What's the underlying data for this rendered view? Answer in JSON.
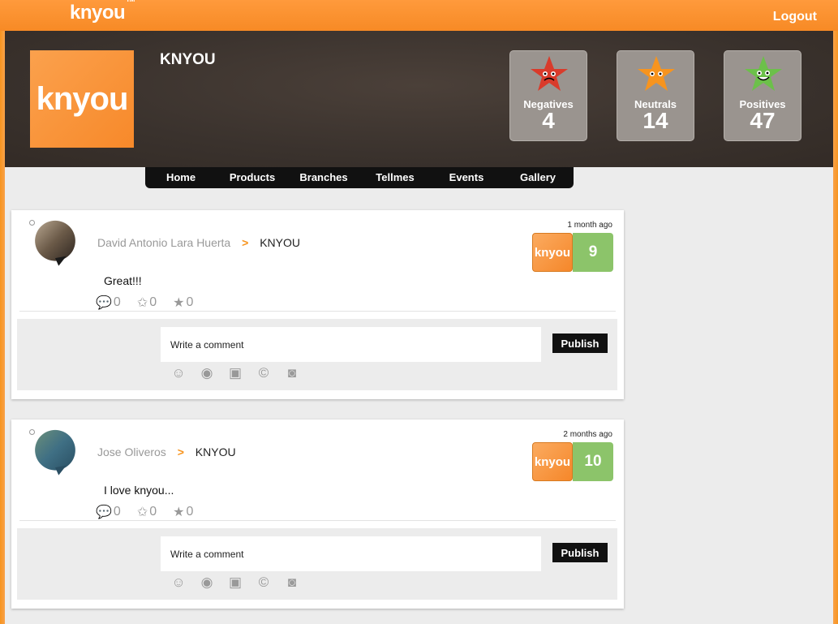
{
  "brand": {
    "name": "knyou",
    "tm": "TM"
  },
  "header": {
    "logout_label": "Logout"
  },
  "profile": {
    "logo_text": "knyou",
    "title": "KNYOU",
    "stats": [
      {
        "label": "Negatives",
        "value": "4",
        "color": "#d93b2b"
      },
      {
        "label": "Neutrals",
        "value": "14",
        "color": "#f7941e"
      },
      {
        "label": "Positives",
        "value": "47",
        "color": "#6cc04a"
      }
    ]
  },
  "nav": [
    "Home",
    "Products",
    "Branches",
    "Tellmes",
    "Events",
    "Gallery"
  ],
  "posts": [
    {
      "author": "David Antonio Lara Huerta",
      "arrow": ">",
      "target": "KNYOU",
      "time": "1 month ago",
      "score_logo": "knyou",
      "score": "9",
      "message": "Great!!!",
      "counts": {
        "comments": "0",
        "stars": "0",
        "favs": "0"
      },
      "comment_placeholder": "Write a comment",
      "publish_label": "Publish"
    },
    {
      "author": "Jose Oliveros",
      "arrow": ">",
      "target": "KNYOU",
      "time": "2 months ago",
      "score_logo": "knyou",
      "score": "10",
      "message": "I love knyou...",
      "counts": {
        "comments": "0",
        "stars": "0",
        "favs": "0"
      },
      "comment_placeholder": "Write a comment",
      "publish_label": "Publish"
    }
  ],
  "icons": {
    "comment": "speech-bubble-icon",
    "star_outline": "star-outline-icon",
    "star": "star-icon",
    "smiley": "smiley-icon",
    "eye": "eye-icon",
    "video": "video-icon",
    "copyright": "copyright-icon",
    "camera": "camera-icon"
  }
}
